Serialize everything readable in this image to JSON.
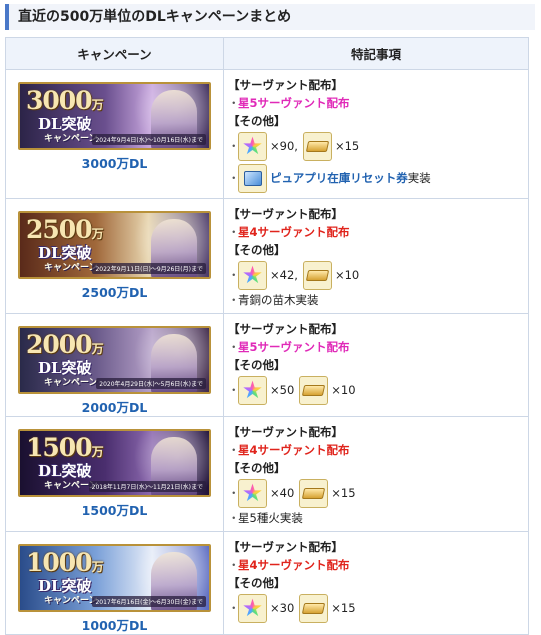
{
  "heading": "直近の500万単位のDLキャンペーンまとめ",
  "columns": {
    "campaign": "キャンペーン",
    "notes": "特記事項"
  },
  "labels": {
    "servant": "【サーヴァント配布】",
    "other": "【その他】",
    "bullet": "・"
  },
  "rows": [
    {
      "banner": {
        "big": "3000",
        "unit": "万",
        "sub": "DL突破",
        "sub2": "キャンペーン",
        "period": "2024年9月4日(水)～10月16日(水)まで"
      },
      "dl": "3000万DL",
      "servant": "星5サーヴァント配布",
      "servant_color": "pink",
      "items": [
        {
          "icon": "rainbow-star-icon",
          "count": "×90,"
        },
        {
          "icon": "gold-ingot-icon",
          "count": "×15"
        }
      ],
      "extra_link": "ピュアプリ在庫リセット券",
      "extra_suffix": "実装"
    },
    {
      "banner": {
        "big": "2500",
        "unit": "万",
        "sub": "DL突破",
        "sub2": "キャンペーン",
        "period": "2022年9月11日(日)～9月26日(月)まで"
      },
      "dl": "2500万DL",
      "servant": "星4サーヴァント配布",
      "servant_color": "red",
      "items": [
        {
          "icon": "rainbow-star-icon",
          "count": "×42,"
        },
        {
          "icon": "gold-ingot-icon",
          "count": "×10"
        }
      ],
      "extra": "青銅の苗木実装"
    },
    {
      "banner": {
        "big": "2000",
        "unit": "万",
        "sub": "DL突破",
        "sub2": "キャンペーン",
        "period": "2020年4月29日(水)～5月6日(水)まで"
      },
      "dl": "2000万DL",
      "servant": "星5サーヴァント配布",
      "servant_color": "pink",
      "items": [
        {
          "icon": "rainbow-star-icon",
          "count": "×50"
        },
        {
          "icon": "gold-ingot-icon",
          "count": "×10"
        }
      ]
    },
    {
      "banner": {
        "big": "1500",
        "unit": "万",
        "sub": "DL突破",
        "sub2": "キャンペーン",
        "period": "2018年11月7日(水)～11月21日(水)まで"
      },
      "dl": "1500万DL",
      "servant": "星4サーヴァント配布",
      "servant_color": "red",
      "items": [
        {
          "icon": "rainbow-star-icon",
          "count": "×40"
        },
        {
          "icon": "gold-ingot-icon",
          "count": "×15"
        }
      ],
      "extra": "星5種火実装"
    },
    {
      "banner": {
        "big": "1000",
        "unit": "万",
        "sub": "DL突破",
        "sub2": "キャンペーン",
        "period": "2017年6月16日(金)～6月30日(金)まで"
      },
      "dl": "1000万DL",
      "servant": "星4サーヴァント配布",
      "servant_color": "red",
      "items": [
        {
          "icon": "rainbow-star-icon",
          "count": "×30"
        },
        {
          "icon": "gold-ingot-icon",
          "count": "×15"
        }
      ]
    }
  ]
}
